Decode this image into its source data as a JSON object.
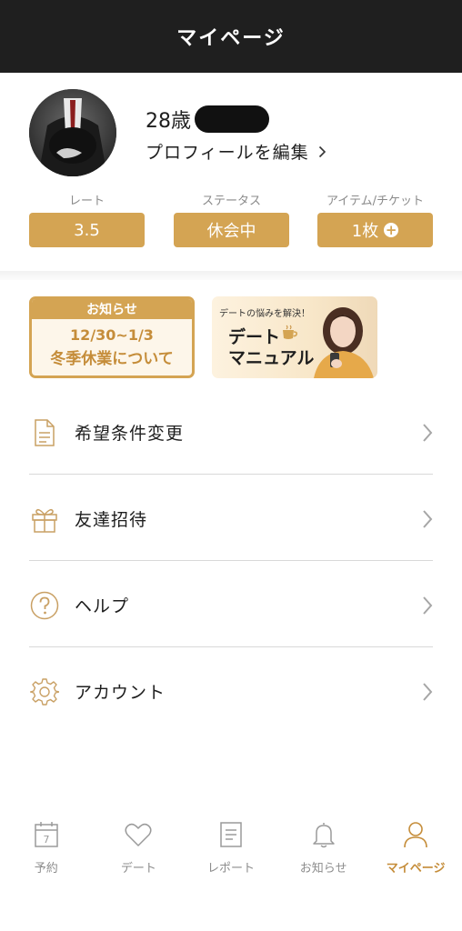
{
  "header": {
    "title": "マイページ"
  },
  "profile": {
    "age": "28歳",
    "edit_label": "プロフィールを編集"
  },
  "stats": [
    {
      "label": "レート",
      "value": "3.5"
    },
    {
      "label": "ステータス",
      "value": "休会中"
    },
    {
      "label": "アイテム/チケット",
      "value": "1枚"
    }
  ],
  "banners": {
    "notice": {
      "head": "お知らせ",
      "date": "12/30~1/3",
      "title": "冬季休業について"
    },
    "date_manual": {
      "sub": "デートの悩みを解決！",
      "line1": "デート",
      "line2": "マニュアル"
    }
  },
  "menu": [
    {
      "label": "希望条件変更",
      "icon": "document-icon"
    },
    {
      "label": "友達招待",
      "icon": "gift-icon"
    },
    {
      "label": "ヘルプ",
      "icon": "help-icon"
    },
    {
      "label": "アカウント",
      "icon": "gear-icon"
    }
  ],
  "nav": [
    {
      "label": "予約",
      "icon": "calendar-icon",
      "calendar_day": "7",
      "active": false
    },
    {
      "label": "デート",
      "icon": "heart-icon",
      "active": false
    },
    {
      "label": "レポート",
      "icon": "report-icon",
      "active": false
    },
    {
      "label": "お知らせ",
      "icon": "bell-icon",
      "active": false
    },
    {
      "label": "マイページ",
      "icon": "person-icon",
      "active": true
    }
  ],
  "colors": {
    "accent": "#d4a453",
    "header_bg": "#1f1f1f",
    "inactive": "#8c8c8c"
  }
}
